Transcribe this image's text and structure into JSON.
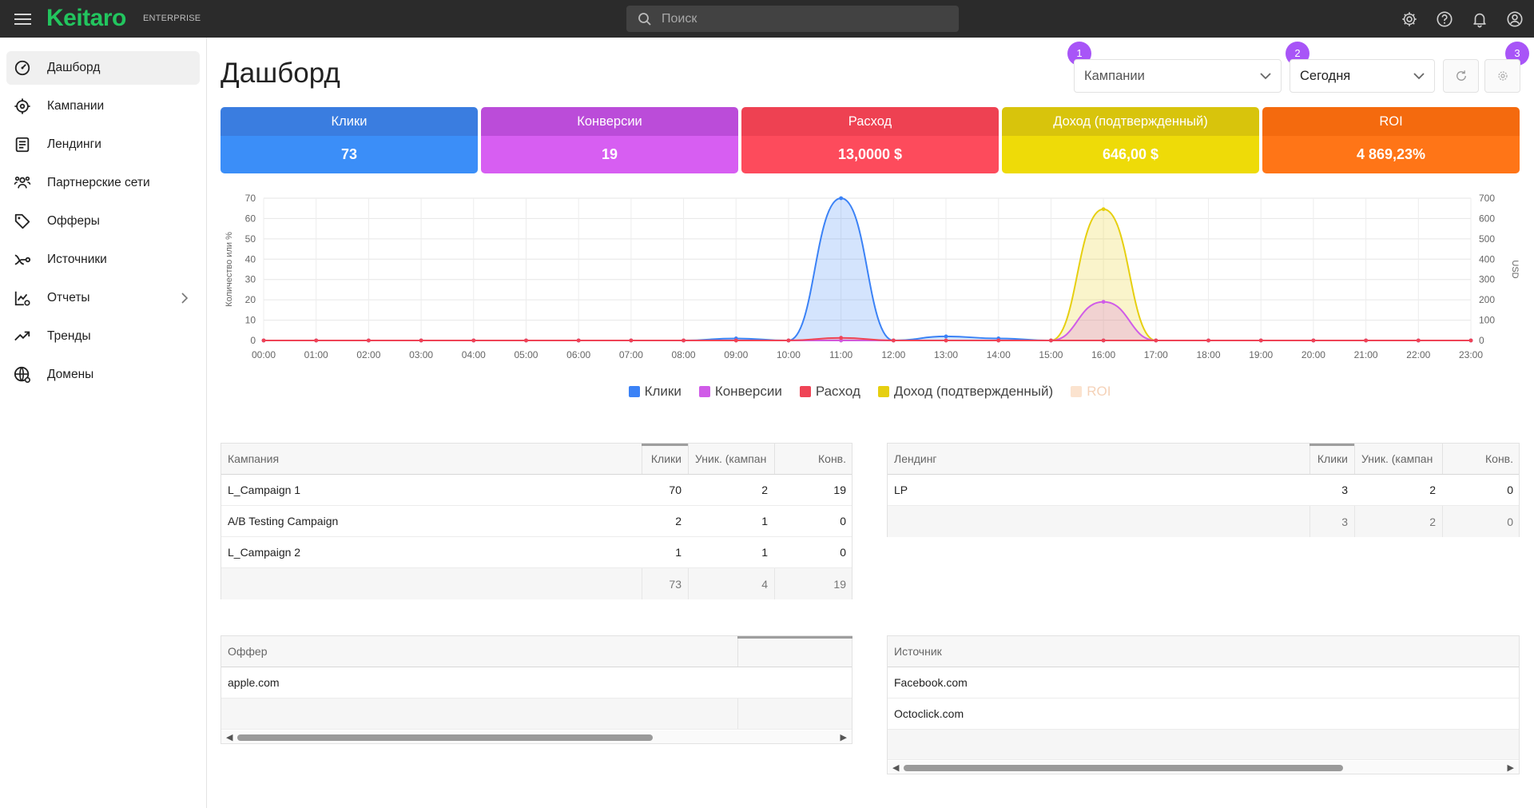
{
  "app": {
    "logo": "Keitaro",
    "edition": "ENTERPRISE"
  },
  "search": {
    "placeholder": "Поиск"
  },
  "sidebar": {
    "items": [
      {
        "label": "Дашборд",
        "icon": "dashboard-icon",
        "active": true
      },
      {
        "label": "Кампании",
        "icon": "target-icon"
      },
      {
        "label": "Лендинги",
        "icon": "landing-page-icon"
      },
      {
        "label": "Партнерские сети",
        "icon": "users-icon"
      },
      {
        "label": "Офферы",
        "icon": "tag-icon"
      },
      {
        "label": "Источники",
        "icon": "source-icon"
      },
      {
        "label": "Отчеты",
        "icon": "report-icon",
        "has_submenu": true
      },
      {
        "label": "Тренды",
        "icon": "trend-icon"
      },
      {
        "label": "Домены",
        "icon": "globe-icon"
      }
    ]
  },
  "page": {
    "title": "Дашборд"
  },
  "controls": {
    "badges": [
      "1",
      "2",
      "3"
    ],
    "group_select": "Кампании",
    "period_select": "Сегодня"
  },
  "kpis": [
    {
      "label": "Клики",
      "value": "73",
      "head_color": "#3a7de0",
      "body_color": "#3b8ef8"
    },
    {
      "label": "Конверсии",
      "value": "19",
      "head_color": "#bb4cd9",
      "body_color": "#d75ef2"
    },
    {
      "label": "Расход",
      "value": "13,0000 $",
      "head_color": "#ee4152",
      "body_color": "#fd4b5c"
    },
    {
      "label": "Доход (подтвержденный)",
      "value": "646,00 $",
      "head_color": "#d8c40c",
      "body_color": "#eedb08"
    },
    {
      "label": "ROI",
      "value": "4 869,23%",
      "head_color": "#f46a0e",
      "body_color": "#ff7517"
    }
  ],
  "chart_data": {
    "type": "area",
    "x": [
      "00:00",
      "01:00",
      "02:00",
      "03:00",
      "04:00",
      "05:00",
      "06:00",
      "07:00",
      "08:00",
      "09:00",
      "10:00",
      "11:00",
      "12:00",
      "13:00",
      "14:00",
      "15:00",
      "16:00",
      "17:00",
      "18:00",
      "19:00",
      "20:00",
      "21:00",
      "22:00",
      "23:00"
    ],
    "ylabel": "Количество или %",
    "y2label": "USD",
    "ylim": [
      0,
      70
    ],
    "y2lim": [
      0,
      700
    ],
    "yticks": [
      0,
      10,
      20,
      30,
      40,
      50,
      60,
      70
    ],
    "y2ticks": [
      0,
      100,
      200,
      300,
      400,
      500,
      600,
      700
    ],
    "grid": true,
    "series": [
      {
        "name": "Клики",
        "axis": "left",
        "color": "#3b82f6",
        "values": [
          0,
          0,
          0,
          0,
          0,
          0,
          0,
          0,
          0,
          1,
          0,
          70,
          0,
          2,
          1,
          0,
          0,
          0,
          0,
          0,
          0,
          0,
          0,
          0
        ]
      },
      {
        "name": "Конверсии",
        "axis": "left",
        "color": "#d05ce8",
        "values": [
          0,
          0,
          0,
          0,
          0,
          0,
          0,
          0,
          0,
          0,
          0,
          0,
          0,
          0,
          0,
          0,
          19,
          0,
          0,
          0,
          0,
          0,
          0,
          0
        ]
      },
      {
        "name": "Расход",
        "axis": "right",
        "color": "#ef4456",
        "values": [
          0,
          0,
          0,
          0,
          0,
          0,
          0,
          0,
          0,
          0,
          0,
          13,
          0,
          0,
          0,
          0,
          0,
          0,
          0,
          0,
          0,
          0,
          0,
          0
        ]
      },
      {
        "name": "Доход (подтвержденный)",
        "axis": "right",
        "color": "#e6cf10",
        "values": [
          0,
          0,
          0,
          0,
          0,
          0,
          0,
          0,
          0,
          0,
          0,
          0,
          0,
          0,
          0,
          0,
          646,
          0,
          0,
          0,
          0,
          0,
          0,
          0
        ]
      },
      {
        "name": "ROI",
        "axis": "right",
        "color": "#fbd7b8",
        "hidden": true,
        "values": []
      }
    ],
    "legend_position": "bottom"
  },
  "tables": {
    "campaigns": {
      "columns": [
        "Кампания",
        "Клики",
        "Уник. (кампан",
        "Конв."
      ],
      "rows": [
        [
          "L_Campaign 1",
          "70",
          "2",
          "19"
        ],
        [
          "A/B Testing Campaign",
          "2",
          "1",
          "0"
        ],
        [
          "L_Campaign 2",
          "1",
          "1",
          "0"
        ]
      ],
      "totals": [
        "73",
        "4",
        "19"
      ]
    },
    "landings": {
      "columns": [
        "Лендинг",
        "Клики",
        "Уник. (кампан",
        "Конв."
      ],
      "rows": [
        [
          "LP",
          "3",
          "2",
          "0"
        ]
      ],
      "totals": [
        "3",
        "2",
        "0"
      ]
    },
    "offers": {
      "columns": [
        "Оффер"
      ],
      "rows": [
        [
          "apple.com"
        ]
      ]
    },
    "sources": {
      "columns": [
        "Источник"
      ],
      "rows": [
        [
          "Facebook.com"
        ],
        [
          "Octoclick.com"
        ]
      ]
    }
  }
}
